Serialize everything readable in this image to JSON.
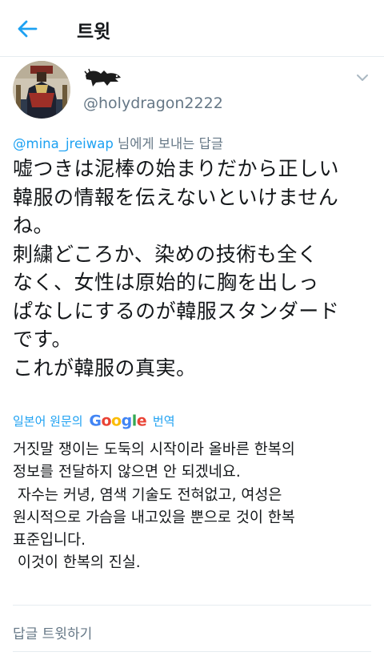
{
  "header": {
    "title": "트윗",
    "back_icon": "arrow-left-icon",
    "accent": "#1da1f2"
  },
  "author": {
    "handle": "@holydragon2222"
  },
  "reply": {
    "mention": "@mina_jreiwap",
    "suffix": " 님에게 보내는 답글"
  },
  "tweet": {
    "lines": [
      "嘘つきは泥棒の始まりだから正しい",
      "韓服の情報を伝えないといけません",
      "ね。",
      "刺繍どころか、染めの技術も全く",
      "なく、女性は原始的に胸を出しっ",
      "ぱなしにするのが韓服スタンダード",
      "です。",
      "これが韓服の真実。"
    ]
  },
  "translate": {
    "prefix": "일본어 원문의",
    "google": [
      "G",
      "o",
      "o",
      "g",
      "l",
      "e"
    ],
    "suffix": "번역"
  },
  "translation": {
    "lines": [
      "거짓말 쟁이는 도둑의 시작이라 올바른 한복의",
      "정보를 전달하지 않으면 안 되겠네요.",
      " 자수는 커녕, 염색 기술도 전혀없고, 여성은",
      "원시적으로 가슴을 내고있을 뿐으로 것이 한복",
      "표준입니다.",
      " 이것이 한복의 진실."
    ]
  },
  "actions": {
    "reply_label": "답글 트윗하기"
  }
}
